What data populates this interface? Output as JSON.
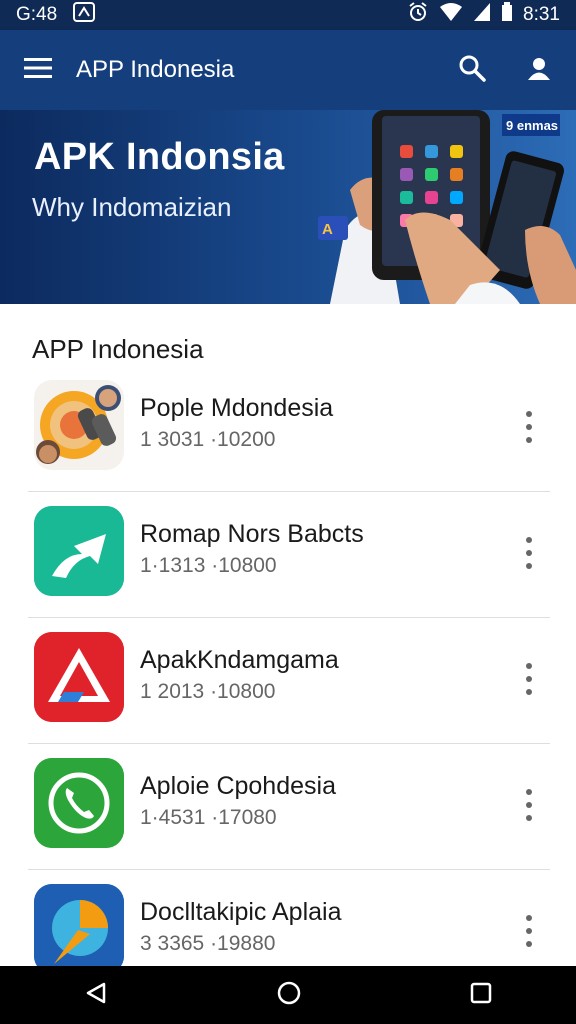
{
  "status_bar": {
    "time_left": "G:48",
    "time_right": "8:31"
  },
  "app_bar": {
    "title": "APP Indonesia"
  },
  "banner": {
    "title": "APK Indonsia",
    "subtitle": "Why Indomaizian",
    "badge": "9 enmas"
  },
  "section_title": "APP Indonesia",
  "apps": [
    {
      "name": "Pople Mdondesia",
      "meta": "1 3031 ·10200",
      "icon": "app-icon-people-binoculars",
      "color": "#ffffff"
    },
    {
      "name": "Romap Nors Babcts",
      "meta": "1·1313 ·10800",
      "icon": "app-icon-teal-arrow",
      "color": "#1abc9c"
    },
    {
      "name": "ApakKndamgama",
      "meta": "1 2013 ·10800",
      "icon": "app-icon-red-triangle",
      "color": "#e0232b"
    },
    {
      "name": "Aploie Cpohdesia",
      "meta": "1·4531 ·17080",
      "icon": "app-icon-phone",
      "color": "#2ca63a"
    },
    {
      "name": "Doclltakipic Aplaia",
      "meta": "3 3365 ·19880",
      "icon": "app-icon-blue-orange",
      "color": "#1f5fb3"
    }
  ]
}
